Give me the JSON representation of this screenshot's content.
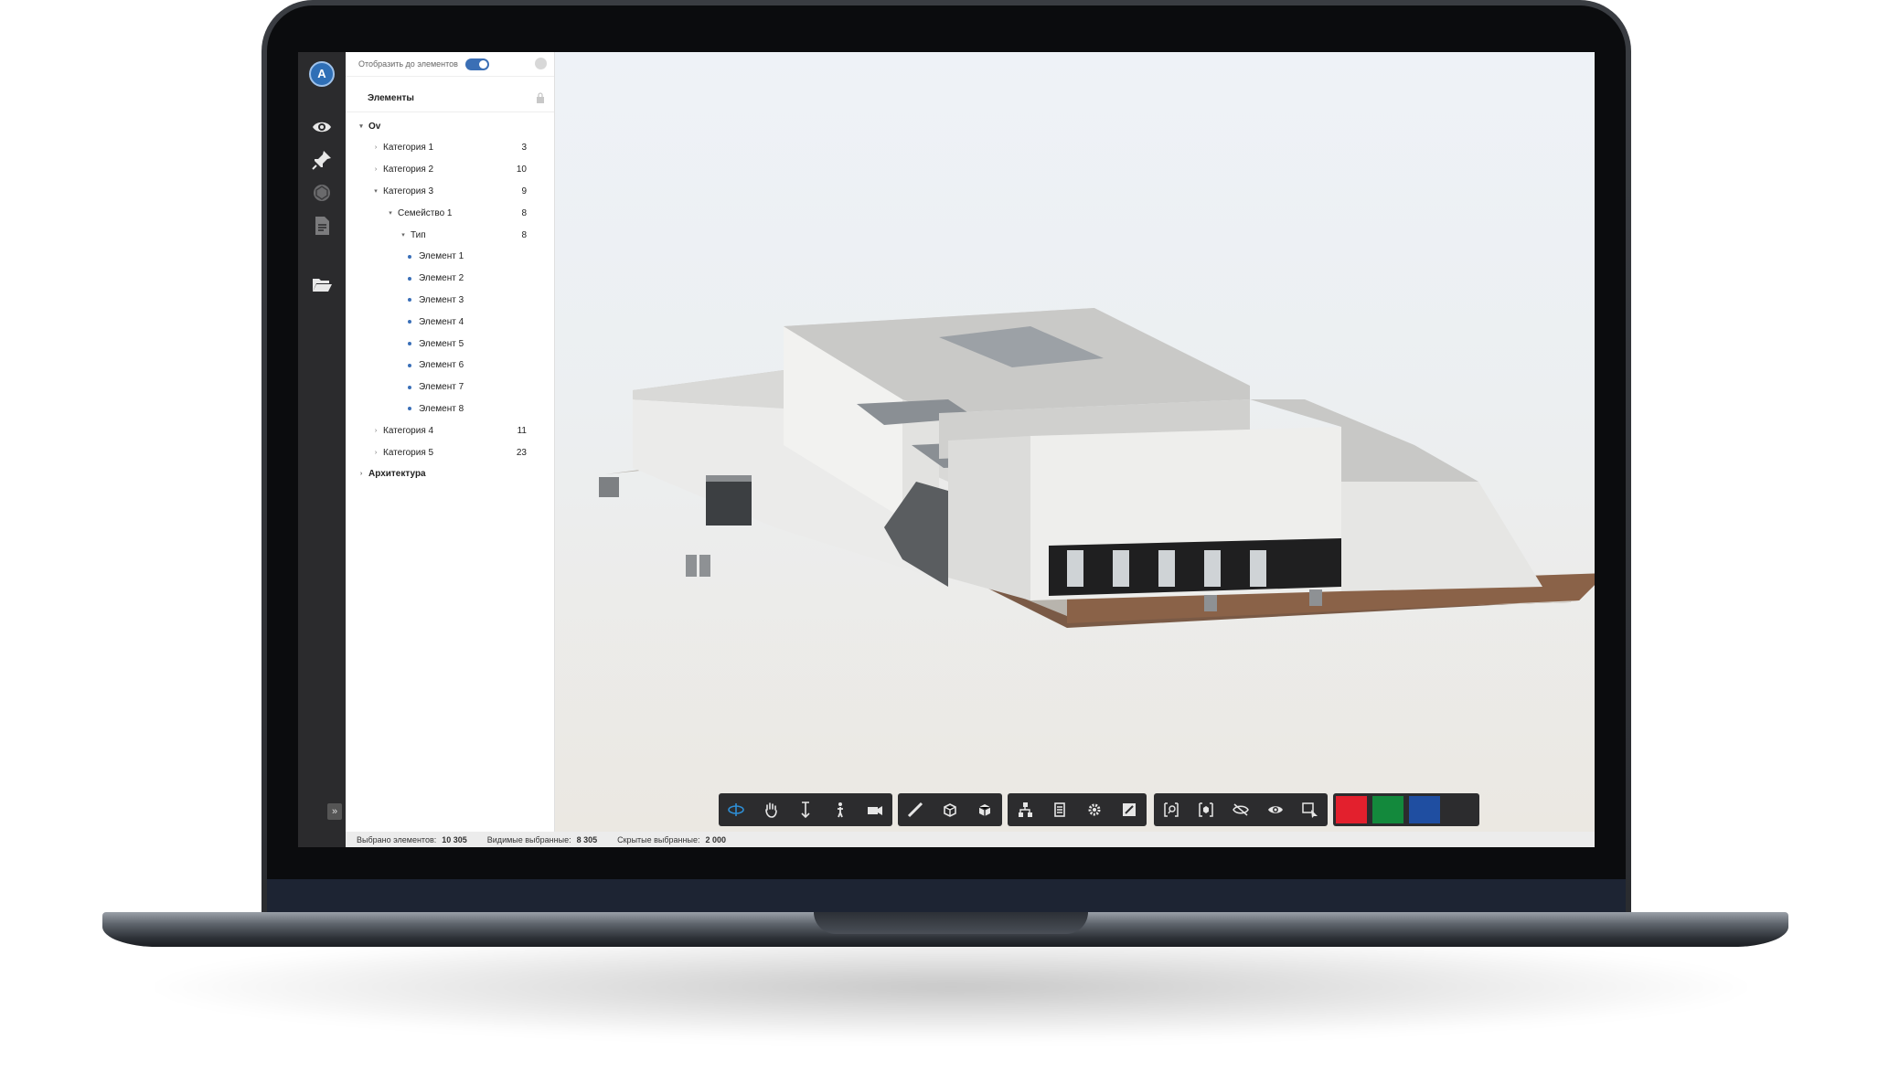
{
  "panel": {
    "display_toggle_label": "Отобразить до элементов",
    "header_title": "Элементы"
  },
  "tree": [
    {
      "label": "Ov",
      "level": 0,
      "expanded": true,
      "bold": true
    },
    {
      "label": "Категория 1",
      "level": 1,
      "count": "3",
      "expanded": false
    },
    {
      "label": "Категория 2",
      "level": 1,
      "count": "10",
      "expanded": false
    },
    {
      "label": "Категория 3",
      "level": 1,
      "count": "9",
      "expanded": true
    },
    {
      "label": "Семейство 1",
      "level": 2,
      "count": "8",
      "expanded": true
    },
    {
      "label": "Тип",
      "level": 3,
      "count": "8",
      "expanded": true
    },
    {
      "label": "Элемент 1",
      "level": 4,
      "leaf": true
    },
    {
      "label": "Элемент 2",
      "level": 4,
      "leaf": true
    },
    {
      "label": "Элемент 3",
      "level": 4,
      "leaf": true
    },
    {
      "label": "Элемент 4",
      "level": 4,
      "leaf": true
    },
    {
      "label": "Элемент 5",
      "level": 4,
      "leaf": true
    },
    {
      "label": "Элемент 6",
      "level": 4,
      "leaf": true
    },
    {
      "label": "Элемент 7",
      "level": 4,
      "leaf": true
    },
    {
      "label": "Элемент 8",
      "level": 4,
      "leaf": true
    },
    {
      "label": "Категория 4",
      "level": 1,
      "count": "11",
      "expanded": false
    },
    {
      "label": "Категория 5",
      "level": 1,
      "count": "23",
      "expanded": false
    },
    {
      "label": "Архитектура",
      "level": 0,
      "expanded": false,
      "bold": true
    }
  ],
  "status": {
    "selected_label": "Выбрано элементов:",
    "selected_value": "10 305",
    "visible_label": "Видимые выбранные:",
    "visible_value": "8 305",
    "hidden_label": "Скрытые выбранные:",
    "hidden_value": "2 000"
  },
  "user": {
    "avatar_initial": "A"
  },
  "rail_icons": [
    "eye-icon",
    "pin-icon",
    "model-icon",
    "document-icon",
    "folder-icon"
  ],
  "toolbar_groups": [
    [
      "orbit-icon",
      "pan-hand-icon",
      "vertical-move-icon",
      "person-walk-icon",
      "camera-icon"
    ],
    [
      "measure-ruler-icon",
      "section-box-icon",
      "cube-icon"
    ],
    [
      "hierarchy-icon",
      "properties-list-icon",
      "settings-gear-icon",
      "fit-view-icon"
    ],
    [
      "zoom-select-icon",
      "isolate-icon",
      "hide-icon",
      "show-icon",
      "select-cursor-icon"
    ]
  ],
  "colors": {
    "accent": "#3b6fb5",
    "swatch_red": "#e3202d",
    "swatch_green": "#13893c",
    "swatch_blue": "#1f4ea1",
    "swatch_dark": "#2c2c2e"
  }
}
